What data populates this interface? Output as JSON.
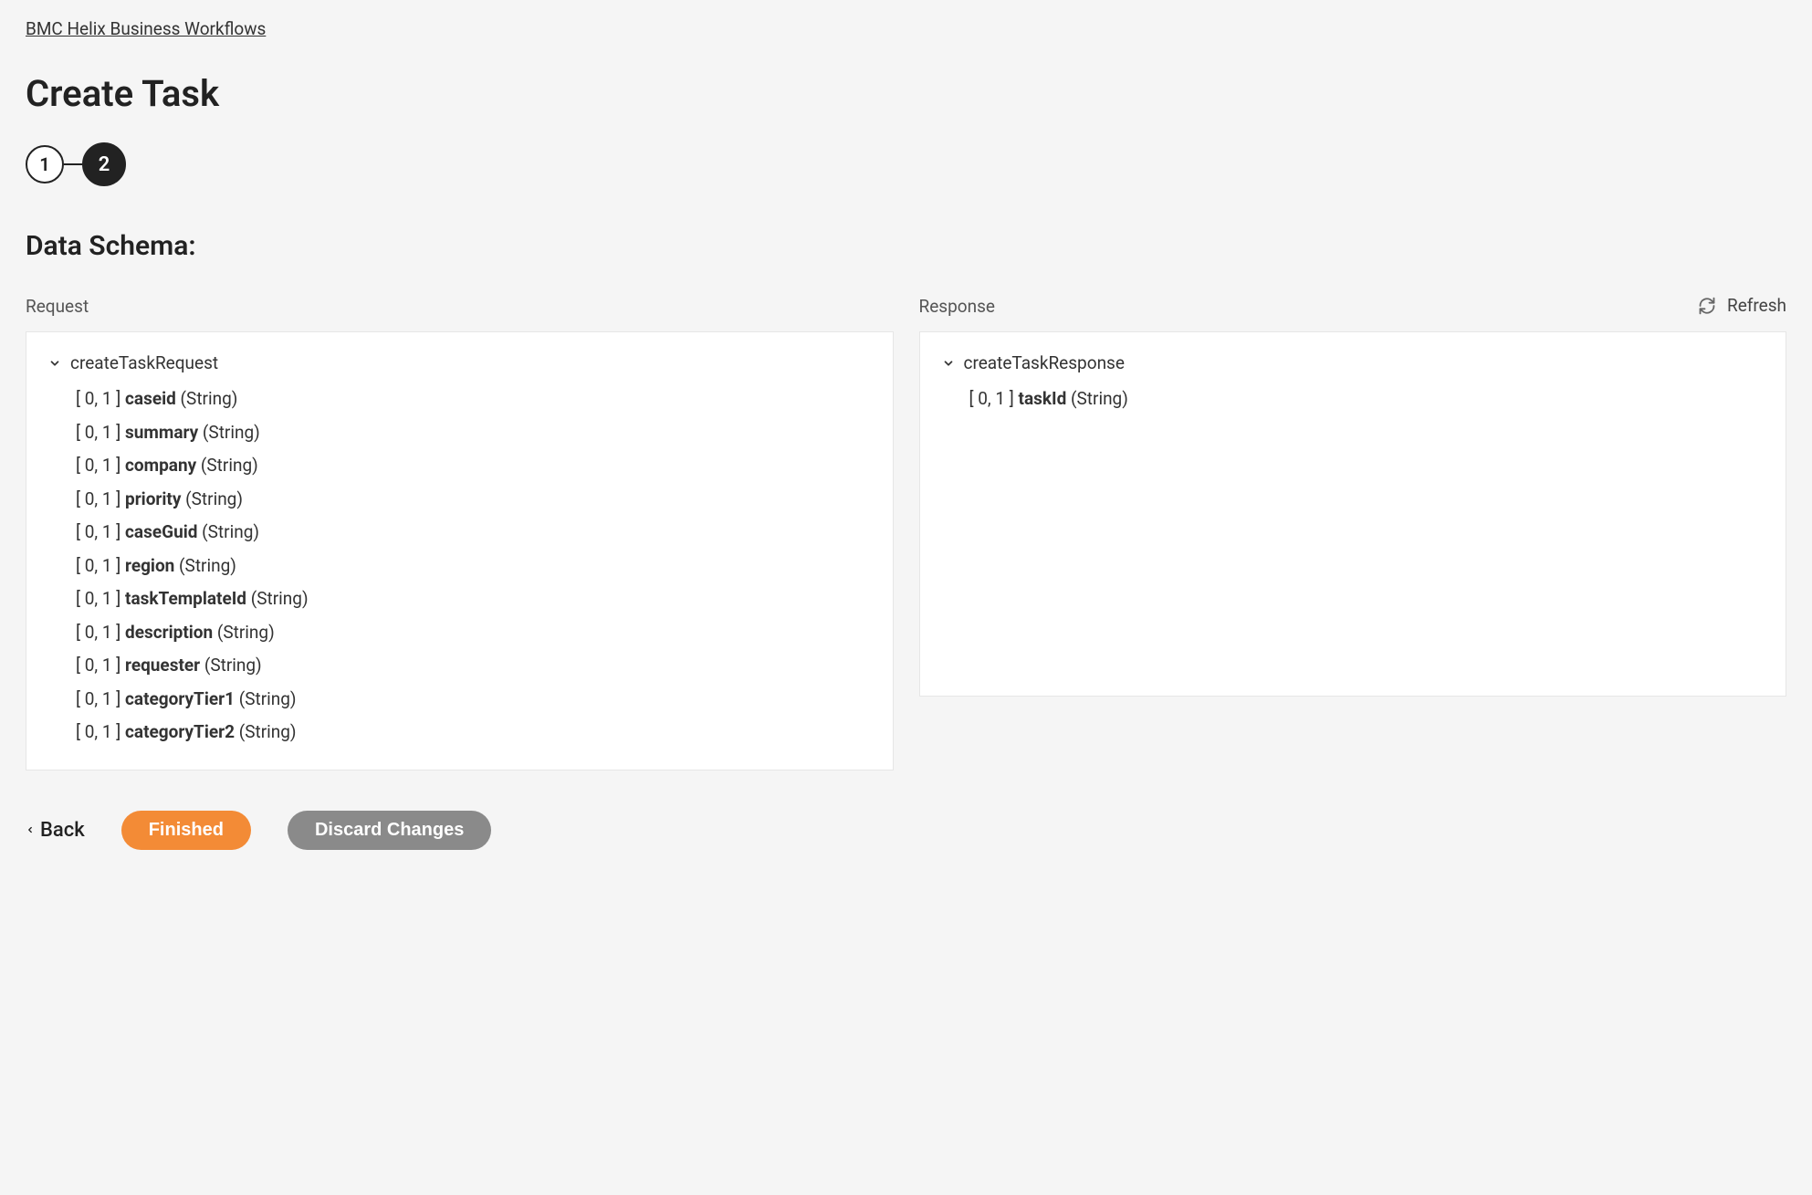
{
  "breadcrumb": "BMC Helix Business Workflows",
  "page_title": "Create Task",
  "stepper": {
    "step1": "1",
    "step2": "2"
  },
  "section_title": "Data Schema:",
  "refresh_label": "Refresh",
  "request": {
    "label": "Request",
    "root": "createTaskRequest",
    "fields": [
      {
        "cardinality": "[ 0, 1 ]",
        "name": "caseid",
        "type": "(String)"
      },
      {
        "cardinality": "[ 0, 1 ]",
        "name": "summary",
        "type": "(String)"
      },
      {
        "cardinality": "[ 0, 1 ]",
        "name": "company",
        "type": "(String)"
      },
      {
        "cardinality": "[ 0, 1 ]",
        "name": "priority",
        "type": "(String)"
      },
      {
        "cardinality": "[ 0, 1 ]",
        "name": "caseGuid",
        "type": "(String)"
      },
      {
        "cardinality": "[ 0, 1 ]",
        "name": "region",
        "type": "(String)"
      },
      {
        "cardinality": "[ 0, 1 ]",
        "name": "taskTemplateId",
        "type": "(String)"
      },
      {
        "cardinality": "[ 0, 1 ]",
        "name": "description",
        "type": "(String)"
      },
      {
        "cardinality": "[ 0, 1 ]",
        "name": "requester",
        "type": "(String)"
      },
      {
        "cardinality": "[ 0, 1 ]",
        "name": "categoryTier1",
        "type": "(String)"
      },
      {
        "cardinality": "[ 0, 1 ]",
        "name": "categoryTier2",
        "type": "(String)"
      }
    ]
  },
  "response": {
    "label": "Response",
    "root": "createTaskResponse",
    "fields": [
      {
        "cardinality": "[ 0, 1 ]",
        "name": "taskId",
        "type": "(String)"
      }
    ]
  },
  "footer": {
    "back": "Back",
    "finished": "Finished",
    "discard": "Discard Changes"
  }
}
